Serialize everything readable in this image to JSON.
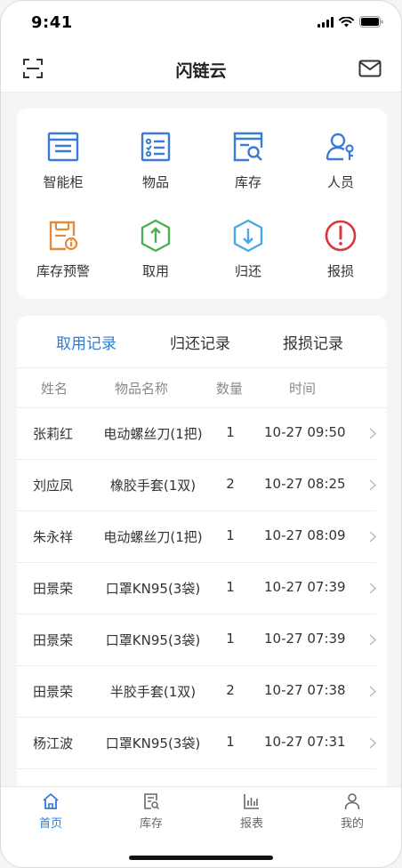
{
  "status_bar": {
    "time": "9:41"
  },
  "header": {
    "title": "闪链云"
  },
  "functions": [
    {
      "label": "智能柜",
      "icon": "cabinet-icon",
      "color": "#3a7bd5"
    },
    {
      "label": "物品",
      "icon": "goods-list-icon",
      "color": "#3a7bd5"
    },
    {
      "label": "库存",
      "icon": "inventory-search-icon",
      "color": "#3a7bd5"
    },
    {
      "label": "人员",
      "icon": "person-key-icon",
      "color": "#3a7bd5"
    },
    {
      "label": "库存预警",
      "icon": "inventory-alert-icon",
      "color": "#e58a3a"
    },
    {
      "label": "取用",
      "icon": "take-out-icon",
      "color": "#4caf50"
    },
    {
      "label": "归还",
      "icon": "return-icon",
      "color": "#4aa8e6"
    },
    {
      "label": "报损",
      "icon": "alert-circle-icon",
      "color": "#d9363e"
    }
  ],
  "records": {
    "tabs": [
      {
        "label": "取用记录",
        "active": true
      },
      {
        "label": "归还记录",
        "active": false
      },
      {
        "label": "报损记录",
        "active": false
      }
    ],
    "columns": [
      "姓名",
      "物品名称",
      "数量",
      "时间"
    ],
    "rows": [
      {
        "name": "张莉红",
        "item": "电动螺丝刀(1把)",
        "qty": "1",
        "time": "10-27 09:50"
      },
      {
        "name": "刘应凤",
        "item": "橡胶手套(1双)",
        "qty": "2",
        "time": "10-27 08:25"
      },
      {
        "name": "朱永祥",
        "item": "电动螺丝刀(1把)",
        "qty": "1",
        "time": "10-27 08:09"
      },
      {
        "name": "田景荣",
        "item": "口罩KN95(3袋)",
        "qty": "1",
        "time": "10-27 07:39"
      },
      {
        "name": "田景荣",
        "item": "口罩KN95(3袋)",
        "qty": "1",
        "time": "10-27 07:39"
      },
      {
        "name": "田景荣",
        "item": "半胶手套(1双)",
        "qty": "2",
        "time": "10-27 07:38"
      },
      {
        "name": "杨江波",
        "item": "口罩KN95(3袋)",
        "qty": "1",
        "time": "10-27 07:31"
      }
    ]
  },
  "tab_bar": [
    {
      "label": "首页",
      "icon": "home-icon",
      "active": true
    },
    {
      "label": "库存",
      "icon": "inventory-icon",
      "active": false
    },
    {
      "label": "报表",
      "icon": "report-chart-icon",
      "active": false
    },
    {
      "label": "我的",
      "icon": "profile-icon",
      "active": false
    }
  ],
  "colors": {
    "accent": "#2f7bd9",
    "background": "#f4f5f7",
    "card": "#ffffff"
  }
}
